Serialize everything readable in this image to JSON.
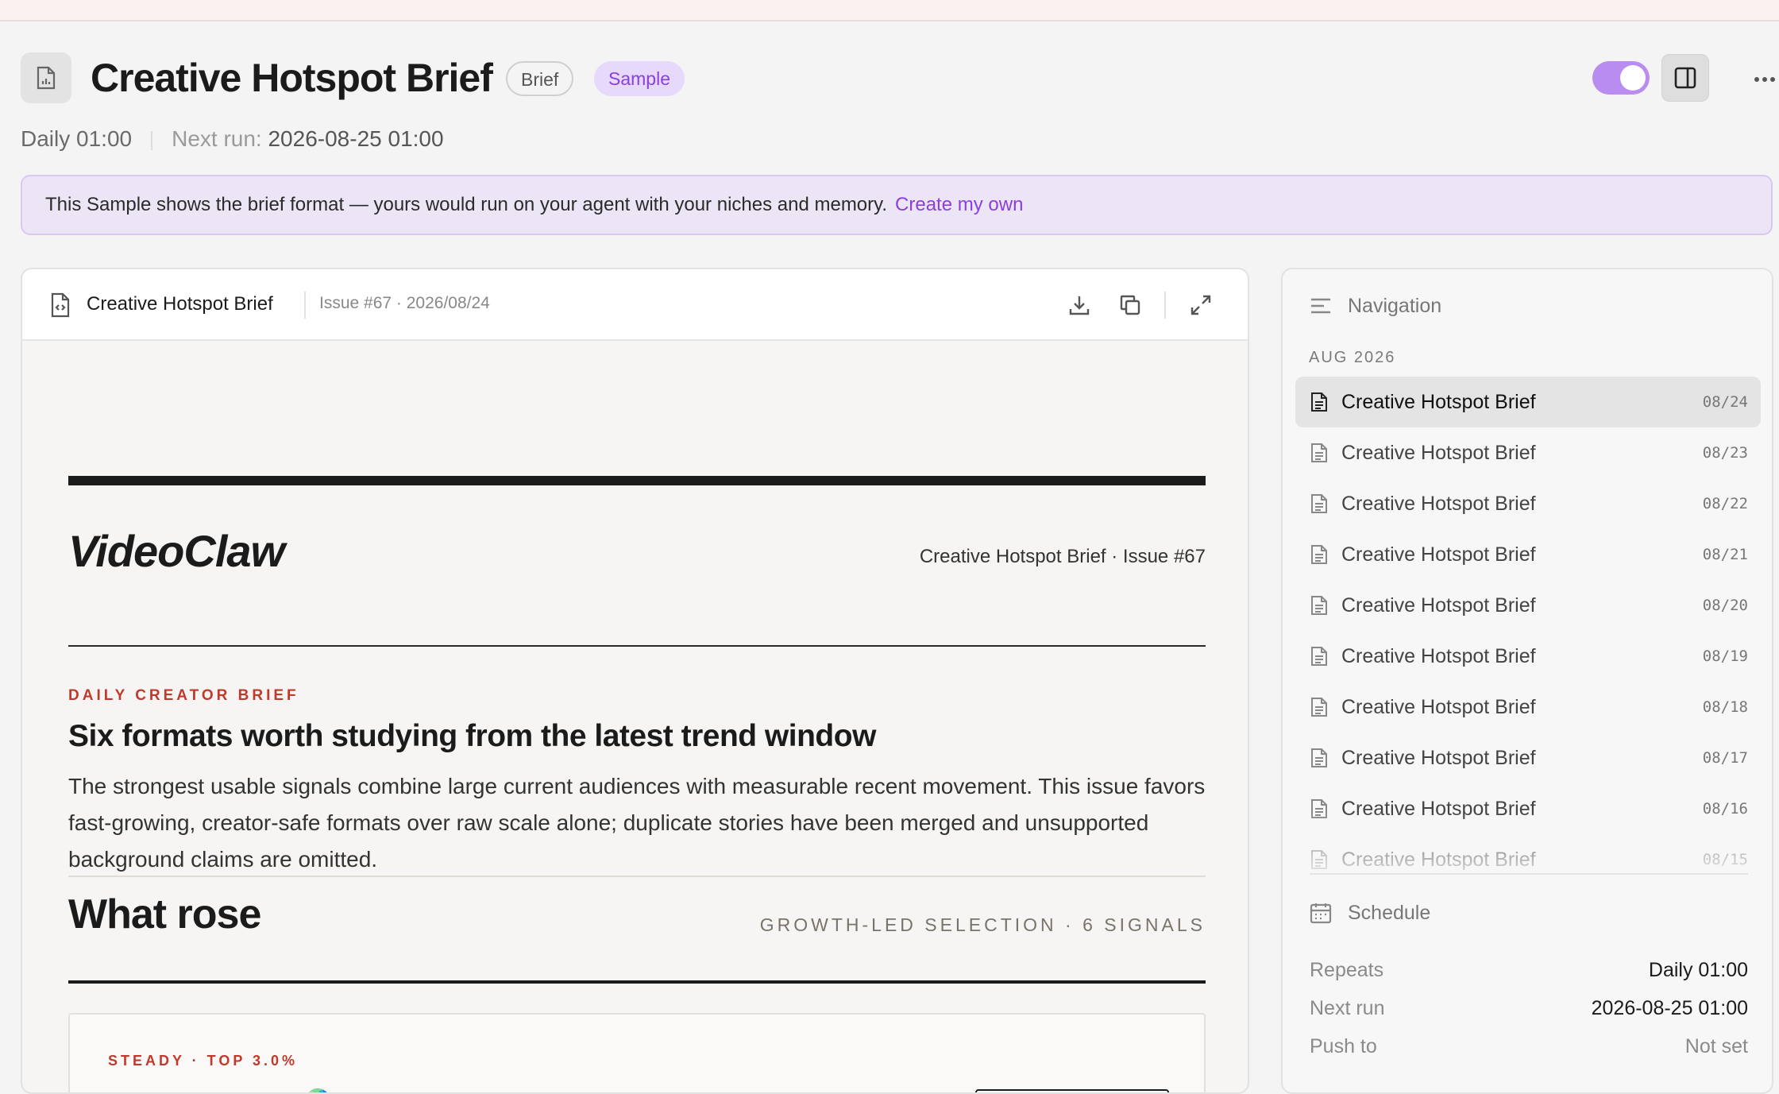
{
  "header": {
    "title": "Creative Hotspot Brief",
    "badges": {
      "brief": "Brief",
      "sample": "Sample"
    },
    "toggle_on": true
  },
  "meta": {
    "schedule": "Daily 01:00",
    "next_run_label": "Next run:",
    "next_run_value": "2026-08-25 01:00"
  },
  "banner": {
    "text": "This Sample shows the brief format — yours would run on your agent with your niches and memory.",
    "link": "Create my own"
  },
  "doc_toolbar": {
    "name": "Creative Hotspot Brief",
    "issue": "Issue #67 · 2026/08/24"
  },
  "brief": {
    "brand": "VideoClaw",
    "brand_meta": "Creative Hotspot Brief · Issue #67",
    "kicker": "DAILY CREATOR BRIEF",
    "headline": "Six formats worth studying from the latest trend window",
    "lede": "The strongest usable signals combine large current audiences with measurable recent movement. This issue favors fast-growing, creator-safe formats over raw scale alone; duplicate stories have been merged and unsupported background claims are omitted.",
    "section_title": "What rose",
    "section_meta": "GROWTH-LED SELECTION · 6 SIGNALS",
    "signal": {
      "kicker": "STEADY · TOP 3.0%",
      "title": "Somewhere in the 🌏, this is someone story . Be kind to"
    }
  },
  "sidebar": {
    "nav_title": "Navigation",
    "month": "AUG 2026",
    "items": [
      {
        "label": "Creative Hotspot Brief",
        "date": "08/24",
        "active": true
      },
      {
        "label": "Creative Hotspot Brief",
        "date": "08/23"
      },
      {
        "label": "Creative Hotspot Brief",
        "date": "08/22"
      },
      {
        "label": "Creative Hotspot Brief",
        "date": "08/21"
      },
      {
        "label": "Creative Hotspot Brief",
        "date": "08/20"
      },
      {
        "label": "Creative Hotspot Brief",
        "date": "08/19"
      },
      {
        "label": "Creative Hotspot Brief",
        "date": "08/18"
      },
      {
        "label": "Creative Hotspot Brief",
        "date": "08/17"
      },
      {
        "label": "Creative Hotspot Brief",
        "date": "08/16"
      },
      {
        "label": "Creative Hotspot Brief",
        "date": "08/15"
      }
    ],
    "schedule_title": "Schedule",
    "schedule": {
      "repeats_label": "Repeats",
      "repeats_value": "Daily 01:00",
      "next_run_label": "Next run",
      "next_run_value": "2026-08-25 01:00",
      "push_label": "Push to",
      "push_value": "Not set"
    }
  },
  "colors": {
    "accent": "#8a3fe0",
    "kicker_red": "#c0392b",
    "toggle": "#b98cf0"
  }
}
